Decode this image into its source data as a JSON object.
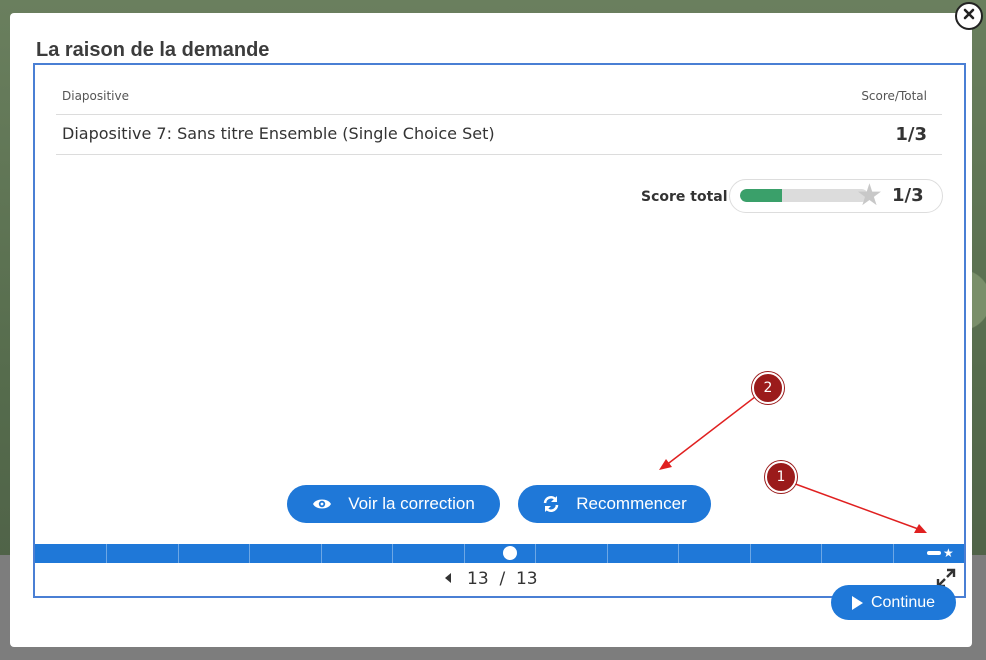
{
  "dialog": {
    "title": "La raison de la demande",
    "close_icon": "close-icon"
  },
  "results_table": {
    "headers": {
      "slide": "Diapositive",
      "score": "Score/Total"
    },
    "rows": [
      {
        "slide": "Diapositive 7: Sans titre Ensemble (Single Choice Set)",
        "score": "1/3"
      }
    ]
  },
  "score_total": {
    "label": "Score total",
    "value": "1/3",
    "progress_fraction": 0.33,
    "bar_color": "#3aa06a",
    "star_icon": "star-icon"
  },
  "actions": {
    "voir_label": "Voir la correction",
    "voir_icon": "eye-icon",
    "recommencer_label": "Recommencer",
    "recommencer_icon": "refresh-icon"
  },
  "navigation": {
    "current_page": "13",
    "separator": "/",
    "total_pages": "13",
    "page_text": "13  /  13",
    "slide_count": 13,
    "current_slide": 7,
    "prev_icon": "caret-left-icon",
    "fullscreen_icon": "fullscreen-icon"
  },
  "continue_button": {
    "label": "Continue",
    "icon": "play-icon"
  },
  "annotations": [
    {
      "number": "1"
    },
    {
      "number": "2"
    }
  ],
  "colors": {
    "accent": "#1f78d8",
    "frame_border": "#4a7fd4",
    "callout": "#9b1b1b",
    "arrow": "#e02020"
  }
}
